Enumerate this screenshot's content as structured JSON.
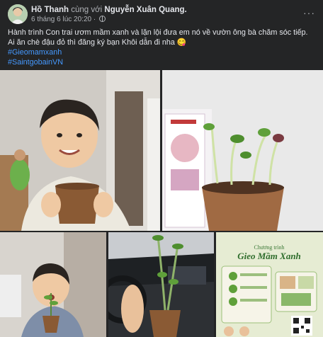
{
  "post": {
    "author": "Hồ Thanh",
    "with_text": "cùng với",
    "tagged": "Nguyễn Xuân Quang.",
    "timestamp": "6 tháng 6 lúc 20:20",
    "privacy_icon": "globe-icon",
    "more_icon": "more-dots-icon",
    "more_glyph": "···",
    "body_lines": [
      "Hành trình Con trai ươm mầm xanh và lặn lội đưa em nó về vườn ông bà chăm sóc tiếp.",
      "Ai ăn chè đậu đỏ thì đăng ký bạn Khôi dẫn đi nha 😋"
    ],
    "hashtags": [
      "#Gieomamxanh",
      "#SaintgobainVN"
    ]
  },
  "poster": {
    "small_title": "Chương trình",
    "title": "Gieo Mầm Xanh"
  },
  "colors": {
    "background": "#242526",
    "text": "#e4e6eb",
    "muted": "#b0b3b8",
    "link": "#4599ff"
  }
}
